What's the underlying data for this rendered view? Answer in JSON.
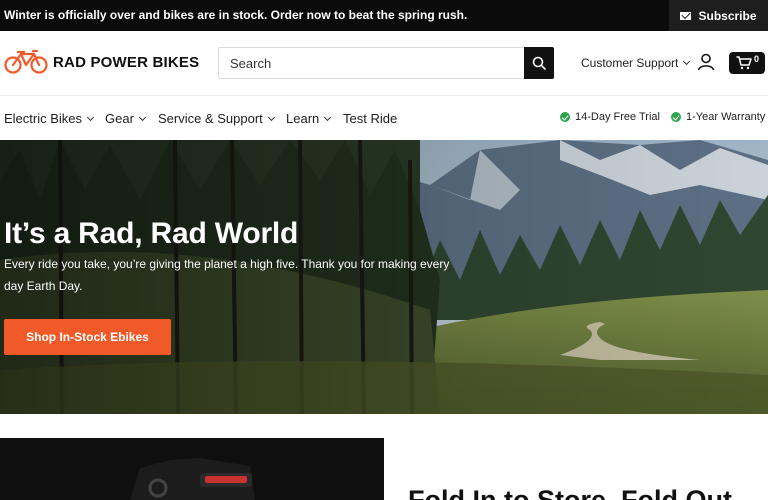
{
  "announcement": {
    "text": "Winter is officially over and bikes are in stock. Order now to beat the spring rush.",
    "subscribe_label": "Subscribe",
    "subscribe_icon": "mail-icon"
  },
  "header": {
    "logo_text": "RAD POWER BIKES",
    "logo_icon": "bicycle-icon",
    "search_placeholder": "Search",
    "search_icon": "search-icon",
    "support_label": "Customer Support",
    "account_icon": "user-icon",
    "cart_icon": "cart-icon",
    "cart_count": "0"
  },
  "nav": {
    "items": [
      {
        "label": "Electric Bikes"
      },
      {
        "label": "Gear"
      },
      {
        "label": "Service & Support"
      },
      {
        "label": "Learn"
      },
      {
        "label": "Test Ride"
      }
    ],
    "perks": [
      {
        "label": "14-Day Free Trial",
        "icon": "check-circle-icon"
      },
      {
        "label": "1-Year Warranty",
        "icon": "check-circle-icon"
      }
    ]
  },
  "hero": {
    "title": "It’s a Rad, Rad World",
    "subtitle": "Every ride you take, you’re giving the planet a high five. Thank you for making every day Earth Day.",
    "cta_label": "Shop In-Stock Ebikes"
  },
  "promo": {
    "title": "Fold In to Store, Fold Out"
  },
  "colors": {
    "accent": "#f05a28",
    "logo_orange": "#f05a28",
    "check_green": "#2ea44f",
    "topbar": "#0b0b0b"
  }
}
